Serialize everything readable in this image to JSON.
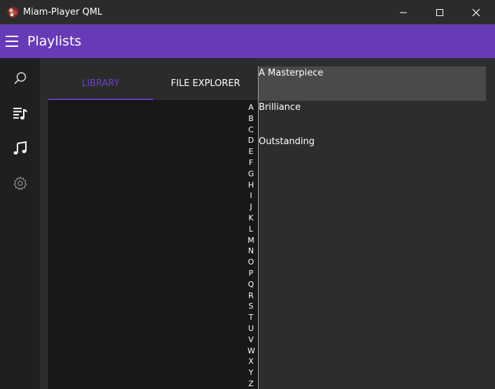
{
  "window": {
    "title": "Miam-Player QML"
  },
  "appbar": {
    "title": "Playlists"
  },
  "tabs": [
    {
      "label": "LIBRARY",
      "selected": true
    },
    {
      "label": "FILE EXPLORER",
      "selected": false
    }
  ],
  "alphabet": [
    "A",
    "B",
    "C",
    "D",
    "E",
    "F",
    "G",
    "H",
    "I",
    "J",
    "K",
    "L",
    "M",
    "N",
    "O",
    "P",
    "Q",
    "R",
    "S",
    "T",
    "U",
    "V",
    "W",
    "X",
    "Y",
    "Z"
  ],
  "playlists": [
    {
      "label": "A Masterpiece",
      "selected": true
    },
    {
      "label": "Brilliance",
      "selected": false
    },
    {
      "label": "Outstanding",
      "selected": false
    }
  ],
  "colors": {
    "accent": "#673ab7",
    "selected_tab": "#6b3fc4"
  },
  "icons": {
    "rail": [
      "search-icon",
      "playlist-icon",
      "music-note-icon",
      "settings-icon"
    ],
    "window": [
      "minimize-icon",
      "maximize-icon",
      "close-icon"
    ]
  }
}
